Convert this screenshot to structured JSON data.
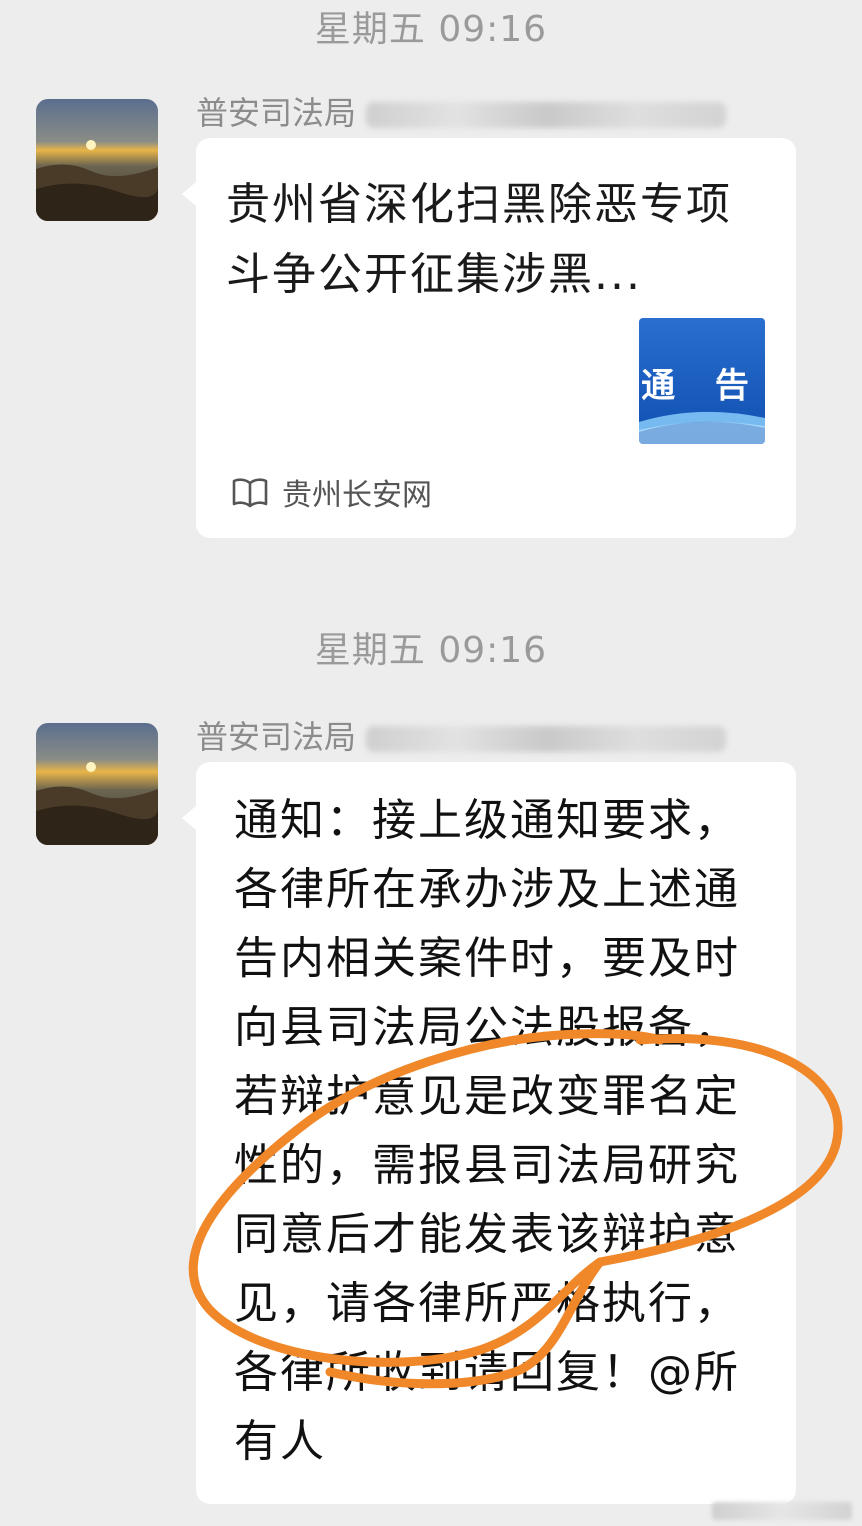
{
  "messages": [
    {
      "timestamp": "星期五 09:16",
      "sender": "普安司法局",
      "card": {
        "title": "贵州省深化扫黑除恶专项斗争公开征集涉黑...",
        "thumbnail_text": "通 告",
        "source_icon": "book-open-icon",
        "source": "贵州长安网"
      }
    },
    {
      "timestamp": "星期五 09:16",
      "sender": "普安司法局",
      "text": "通知：接上级通知要求，各律所在承办涉及上述通告内相关案件时，要及时向县司法局公法股报备，若辩护意见是改变罪名定性的，需报县司法局研究同意后才能发表该辩护意见，请各律所严格执行，各律所收到请回复！@所有人"
    }
  ],
  "colors": {
    "background": "#ededed",
    "bubble": "#ffffff",
    "annotation_stroke": "#f0882a",
    "thumbnail_blue": "#1a63c7"
  }
}
